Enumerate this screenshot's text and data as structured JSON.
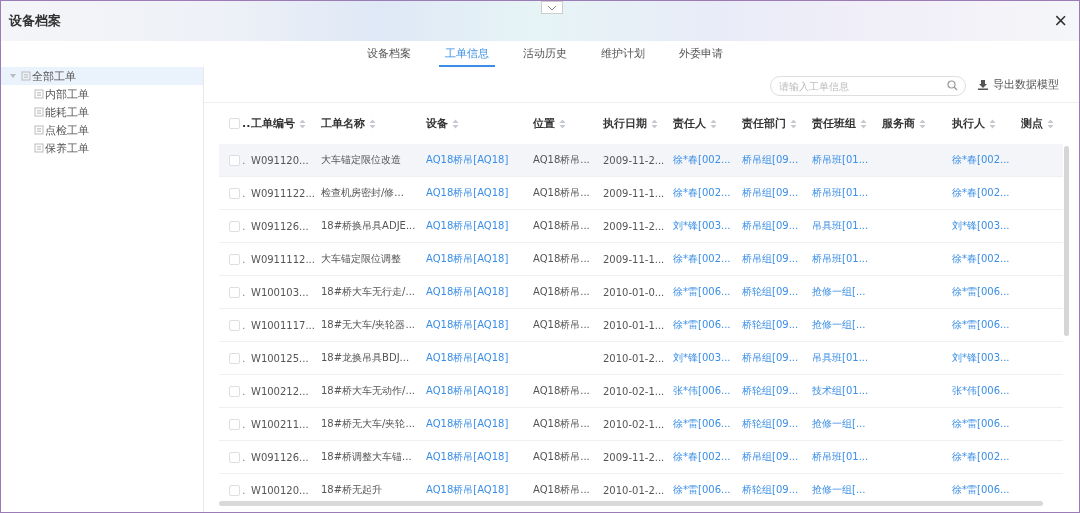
{
  "window": {
    "title": "设备档案",
    "close_label": "×"
  },
  "tabs": [
    {
      "label": "设备档案",
      "selected": false
    },
    {
      "label": "工单信息",
      "selected": true
    },
    {
      "label": "活动历史",
      "selected": false
    },
    {
      "label": "维护计划",
      "selected": false
    },
    {
      "label": "外委申请",
      "selected": false
    }
  ],
  "tree": [
    {
      "label": "全部工单",
      "selected": true,
      "expanded": true,
      "children": [
        {
          "label": "内部工单",
          "selected": false
        },
        {
          "label": "能耗工单",
          "selected": false
        },
        {
          "label": "点检工单",
          "selected": false
        },
        {
          "label": "保养工单",
          "selected": false
        }
      ]
    }
  ],
  "search": {
    "placeholder": "请输入工单信息"
  },
  "export_button": {
    "label": "导出数据模型"
  },
  "table": {
    "select_all": {
      "checked": false,
      "label": ".."
    },
    "columns": [
      {
        "label": "工单编号",
        "kind": "text"
      },
      {
        "label": "工单名称",
        "kind": "text"
      },
      {
        "label": "设备",
        "kind": "link"
      },
      {
        "label": "位置",
        "kind": "text"
      },
      {
        "label": "执行日期",
        "kind": "text"
      },
      {
        "label": "责任人",
        "kind": "link"
      },
      {
        "label": "责任部门",
        "kind": "link"
      },
      {
        "label": "责任班组",
        "kind": "link"
      },
      {
        "label": "服务商"
      },
      {
        "label": "执行人",
        "kind": "link"
      },
      {
        "label": "测点"
      }
    ],
    "rows": [
      {
        "highlighted": true,
        "checked": false,
        "cut": ".",
        "cells": [
          "W091120...",
          "大车锚定限位改造",
          "AQ18桥吊[AQ18]",
          "AQ18桥吊...",
          "2009-11-2...",
          "徐*春[002...",
          "桥吊组[09...",
          "桥吊班[01...",
          null,
          "徐*春[002...",
          null
        ]
      },
      {
        "highlighted": false,
        "checked": false,
        "cut": ".",
        "cells": [
          "W0911122...",
          "检查机房密封/修...",
          "AQ18桥吊[AQ18]",
          "AQ18桥吊...",
          "2009-11-1...",
          "徐*春[002...",
          "桥吊组[09...",
          "桥吊班[01...",
          null,
          "徐*春[002...",
          null
        ]
      },
      {
        "highlighted": false,
        "checked": false,
        "cut": ".",
        "cells": [
          "W091126...",
          "18#桥换吊具ADJE...",
          "AQ18桥吊[AQ18]",
          "AQ18桥吊...",
          "2009-11-2...",
          "刘*锋[003...",
          "桥吊组[09...",
          "吊具班[01...",
          null,
          "刘*锋[003...",
          null
        ]
      },
      {
        "highlighted": false,
        "checked": false,
        "cut": ".",
        "cells": [
          "W0911112...",
          "大车锚定限位调整",
          "AQ18桥吊[AQ18]",
          "AQ18桥吊...",
          "2009-11-1...",
          "徐*春[002...",
          "桥吊组[09...",
          "桥吊班[01...",
          null,
          "徐*春[002...",
          null
        ]
      },
      {
        "highlighted": false,
        "checked": false,
        "cut": ".",
        "cells": [
          "W100103...",
          "18#桥大车无行走/...",
          "AQ18桥吊[AQ18]",
          "AQ18桥吊...",
          "2010-01-0...",
          "徐*雷[006...",
          "桥轮组[09...",
          "抢修一组[...",
          null,
          "徐*雷[006...",
          null
        ]
      },
      {
        "highlighted": false,
        "checked": false,
        "cut": ".",
        "cells": [
          "W1001117...",
          "18#无大车/夹轮器...",
          "AQ18桥吊[AQ18]",
          "AQ18桥吊...",
          "2010-01-1...",
          "徐*雷[006...",
          "桥轮组[09...",
          "抢修一组[...",
          null,
          "徐*雷[006...",
          null
        ]
      },
      {
        "highlighted": false,
        "checked": false,
        "cut": ".",
        "cells": [
          "W100125...",
          "18#龙换吊具BDJ...",
          "AQ18桥吊[AQ18]",
          null,
          "2010-01-2...",
          "刘*锋[003...",
          "桥吊组[09...",
          "吊具班[01...",
          null,
          "刘*锋[003...",
          null
        ]
      },
      {
        "highlighted": false,
        "checked": false,
        "cut": ".",
        "cells": [
          "W100212...",
          "18#桥大车无动作/...",
          "AQ18桥吊[AQ18]",
          "AQ18桥吊...",
          "2010-02-1...",
          "张*伟[006...",
          "桥轮组[09...",
          "技术组[01...",
          null,
          "张*伟[006...",
          null
        ]
      },
      {
        "highlighted": false,
        "checked": false,
        "cut": ".",
        "cells": [
          "W100211...",
          "18#桥无大车/夹轮...",
          "AQ18桥吊[AQ18]",
          "AQ18桥吊...",
          "2010-02-1...",
          "徐*雷[006...",
          "桥轮组[09...",
          "抢修一组[...",
          null,
          "徐*雷[006...",
          null
        ]
      },
      {
        "highlighted": false,
        "checked": false,
        "cut": ".",
        "cells": [
          "W091126...",
          "18#桥调整大车锚...",
          "AQ18桥吊[AQ18]",
          "AQ18桥吊...",
          "2009-11-2...",
          "徐*春[002...",
          "桥吊组[09...",
          "桥吊班[01...",
          null,
          "徐*春[002...",
          null
        ]
      },
      {
        "highlighted": false,
        "checked": false,
        "cut": ".",
        "cells": [
          "W100120...",
          "18#桥无起升",
          "AQ18桥吊[AQ18]",
          "AQ18桥吊...",
          "2010-01-2...",
          "徐*雷[006...",
          "桥轮组[09...",
          "抢修一组[...",
          null,
          "徐*雷[006...",
          null
        ]
      }
    ]
  }
}
